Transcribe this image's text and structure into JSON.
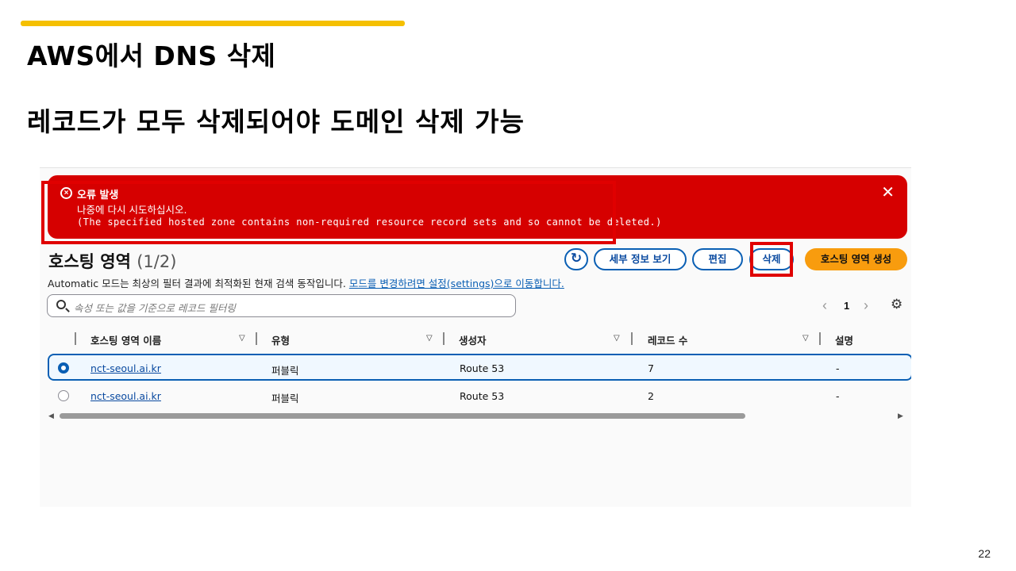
{
  "slide": {
    "title": "AWS에서 DNS 삭제",
    "subtitle": "레코드가 모두 삭제되어야 도메인 삭제 가능",
    "page_number": "22",
    "accent_color": "#f5c000"
  },
  "flash": {
    "title": "오류 발생",
    "message": "나중에 다시 시도하십시오.",
    "detail": "(The specified hosted zone contains non-required resource record sets and so cannot be deleted.)",
    "background_color": "#d60000",
    "icon": "error-circle-icon",
    "close_icon": "close-icon"
  },
  "header": {
    "title": "호스팅 영역",
    "count": "(1/2)",
    "refresh_icon": "refresh-icon"
  },
  "toolbar": {
    "details_label": "세부 정보 보기",
    "edit_label": "편집",
    "delete_label": "삭제",
    "create_label": "호스팅 영역 생성",
    "primary_color": "#f89c0e"
  },
  "description": {
    "text": "Automatic 모드는 최상의 필터 결과에 최적화된 현재 검색 동작입니다.",
    "link": "모드를 변경하려면 설정(settings)으로 이동합니다."
  },
  "search": {
    "placeholder": "속성 또는 값을 기준으로 레코드 필터링"
  },
  "pagination": {
    "current_page": "1",
    "prev_icon": "chevron-left-icon",
    "next_icon": "chevron-right-icon",
    "settings_icon": "gear-icon"
  },
  "table": {
    "columns": [
      "호스팅 영역 이름",
      "유형",
      "생성자",
      "레코드 수",
      "설명"
    ],
    "rows": [
      {
        "selected": true,
        "name": "nct-seoul.ai.kr",
        "type": "퍼블릭",
        "created_by": "Route 53",
        "record_count": "7",
        "description": "-"
      },
      {
        "selected": false,
        "name": "nct-seoul.ai.kr",
        "type": "퍼블릭",
        "created_by": "Route 53",
        "record_count": "2",
        "description": "-"
      }
    ]
  },
  "highlight_color": "#e00000"
}
